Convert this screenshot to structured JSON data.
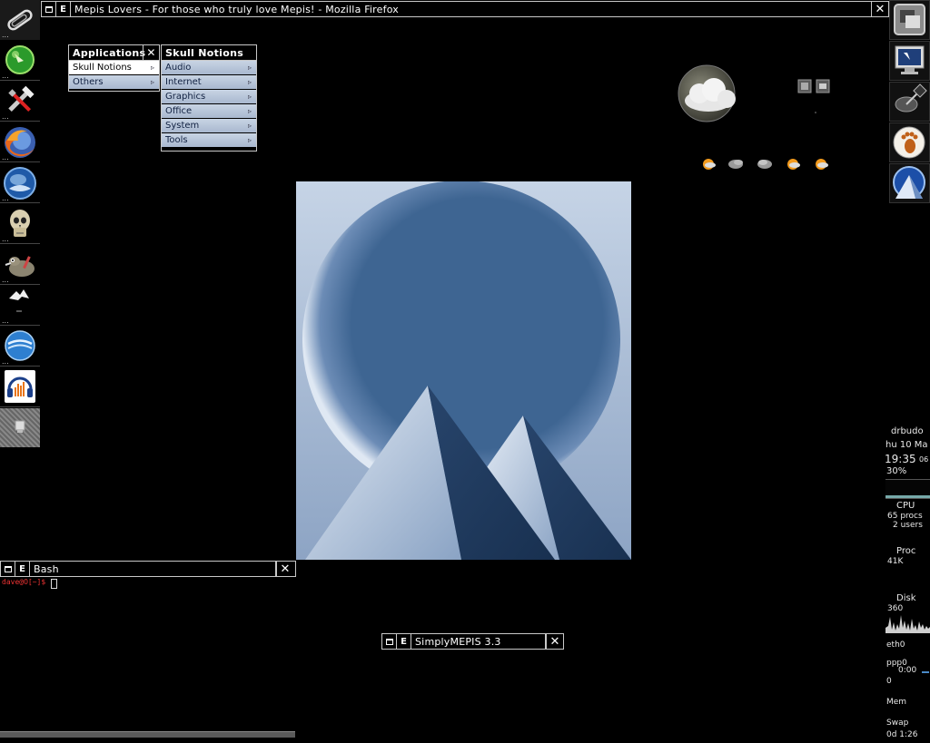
{
  "firefox_window": {
    "min_glyph": "",
    "menu_glyph": "E",
    "title": "Mepis Lovers - For those who truly love Mepis! - Mozilla Firefox",
    "close_glyph": "✕"
  },
  "bash_window": {
    "menu_glyph": "E",
    "title": "Bash",
    "close_glyph": "✕",
    "prompt": "dave@O[~]$"
  },
  "mepis_window": {
    "menu_glyph": "E",
    "title": "SimplyMEPIS 3.3",
    "close_glyph": "✕"
  },
  "applications_menu": {
    "title": "Applications",
    "close_glyph": "✕",
    "items": [
      {
        "label": "Skull Notions",
        "arrow": "▹"
      },
      {
        "label": "Others",
        "arrow": "▹"
      }
    ]
  },
  "skull_menu": {
    "title": "Skull Notions",
    "items": [
      {
        "label": "Audio",
        "arrow": "▹"
      },
      {
        "label": "Internet",
        "arrow": "▹"
      },
      {
        "label": "Graphics",
        "arrow": "▹"
      },
      {
        "label": "Office",
        "arrow": "▹"
      },
      {
        "label": "System",
        "arrow": "▹"
      },
      {
        "label": "Tools",
        "arrow": "▹"
      }
    ]
  },
  "left_dock": {
    "items": [
      {
        "icon": "paperclip-icon",
        "dots": "..."
      },
      {
        "icon": "green-globe-icon",
        "dots": "..."
      },
      {
        "icon": "tools-icon",
        "dots": "..."
      },
      {
        "icon": "firefox-icon",
        "dots": "..."
      },
      {
        "icon": "thunderbird-icon",
        "dots": "..."
      },
      {
        "icon": "skull-icon",
        "dots": "..."
      },
      {
        "icon": "gimp-icon",
        "dots": "..."
      },
      {
        "icon": "bird-icon",
        "dots": "..."
      },
      {
        "icon": "openoffice-icon",
        "dots": "..."
      },
      {
        "icon": "audacity-icon",
        "dots": ""
      },
      {
        "icon": "clip-icon",
        "dots": ""
      }
    ]
  },
  "right_dock": {
    "items": [
      "workspace-icon",
      "monitor-icon",
      "satellite-icon",
      "gnome-foot-icon",
      "mepis-icon"
    ]
  },
  "gkrellm": {
    "hostname": "drbudo",
    "date": "hu 10 Ma",
    "time": "19:35",
    "seconds": "06",
    "battery": "30%",
    "cpu_label": "CPU",
    "procs": "65 procs",
    "users": "2 users",
    "proc_label": "Proc",
    "proc_value": "41K",
    "disk_label": "Disk",
    "disk_value": "360",
    "eth_label": "eth0",
    "ppp_label": "ppp0",
    "ppp_time": "0:00",
    "ppp_value": "0",
    "mem_label": "Mem",
    "swap_label": "Swap",
    "uptime": "0d  1:26"
  },
  "colors": {
    "menu_item_bg": "#b4c2d8",
    "menu_item_text": "#102040",
    "wallpaper_bg": "#8da4c4",
    "moon": "#3e6592",
    "pyramid_dark": "#203a5e"
  }
}
